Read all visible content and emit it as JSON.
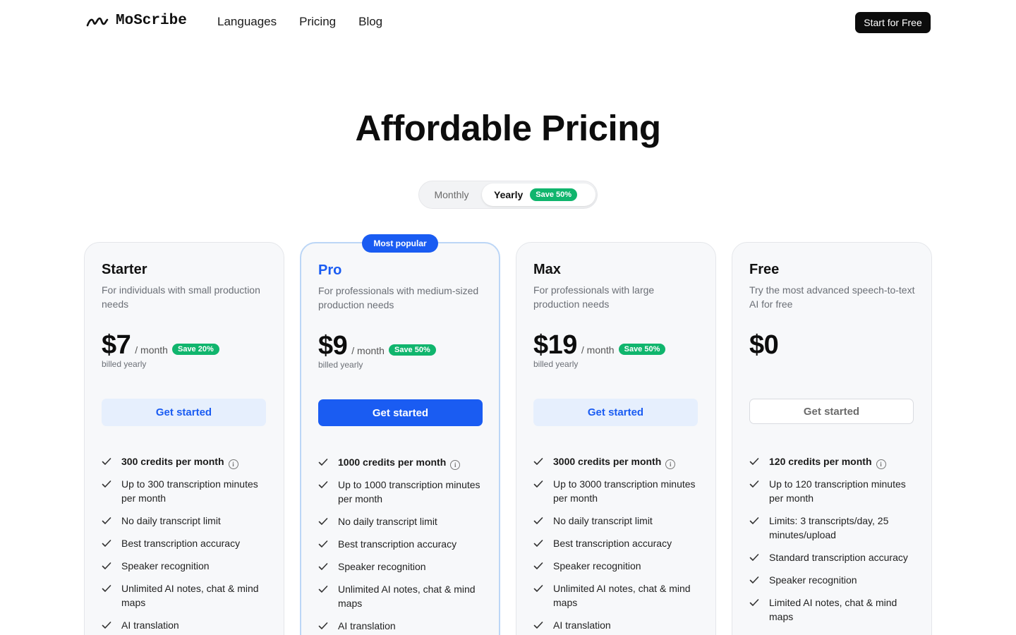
{
  "brand": {
    "name": "MoScribe"
  },
  "nav": {
    "items": [
      "Languages",
      "Pricing",
      "Blog"
    ]
  },
  "header": {
    "cta": "Start for Free"
  },
  "hero": {
    "title": "Affordable Pricing"
  },
  "billing_toggle": {
    "monthly": "Monthly",
    "yearly": "Yearly",
    "yearly_badge": "Save 50%",
    "selected": "Yearly"
  },
  "colors": {
    "accent": "#1a5cf2",
    "save_green": "#10b56d",
    "card_bg": "#f7f8fa"
  },
  "plans": [
    {
      "name": "Starter",
      "description": "For individuals with small production needs",
      "price": "$7",
      "per": "/ month",
      "save": "Save 20%",
      "billed": "billed yearly",
      "button": "Get started",
      "features": [
        "300 credits per month",
        "Up to 300 transcription minutes per month",
        "No daily transcript limit",
        "Best transcription accuracy",
        "Speaker recognition",
        "Unlimited AI notes, chat & mind maps",
        "AI translation"
      ]
    },
    {
      "name": "Pro",
      "badge": "Most popular",
      "description": "For professionals with medium-sized production needs",
      "price": "$9",
      "per": "/ month",
      "save": "Save 50%",
      "billed": "billed yearly",
      "button": "Get started",
      "features": [
        "1000 credits per month",
        "Up to 1000 transcription minutes per month",
        "No daily transcript limit",
        "Best transcription accuracy",
        "Speaker recognition",
        "Unlimited AI notes, chat & mind maps",
        "AI translation"
      ]
    },
    {
      "name": "Max",
      "description": "For professionals with large production needs",
      "price": "$19",
      "per": "/ month",
      "save": "Save 50%",
      "billed": "billed yearly",
      "button": "Get started",
      "features": [
        "3000 credits per month",
        "Up to 3000 transcription minutes per month",
        "No daily transcript limit",
        "Best transcription accuracy",
        "Speaker recognition",
        "Unlimited AI notes, chat & mind maps",
        "AI translation"
      ]
    },
    {
      "name": "Free",
      "description": "Try the most advanced speech-to-text AI for free",
      "price": "$0",
      "button": "Get started",
      "features": [
        "120 credits per month",
        "Up to 120 transcription minutes per month",
        "Limits: 3 transcripts/day, 25 minutes/upload",
        "Standard transcription accuracy",
        "Speaker recognition",
        "Limited AI notes, chat & mind maps"
      ]
    }
  ]
}
